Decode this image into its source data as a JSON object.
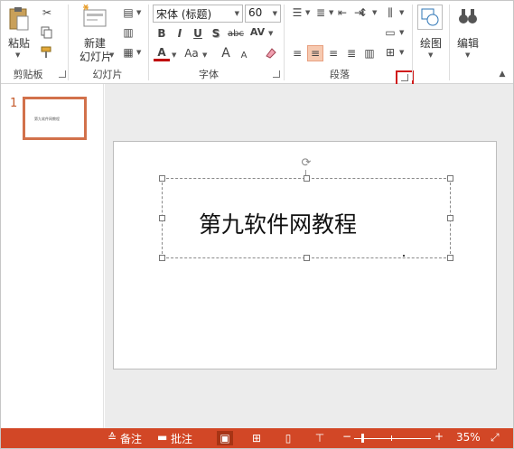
{
  "ribbon": {
    "clipboard": {
      "paste_label": "粘贴",
      "group_label": "剪贴板"
    },
    "slides": {
      "new_slide_label_line1": "新建",
      "new_slide_label_line2": "幻灯片",
      "group_label": "幻灯片"
    },
    "font": {
      "font_name": "宋体 (标题)",
      "font_size": "60",
      "group_label": "字体",
      "bold": "B",
      "italic": "I",
      "underline": "U",
      "shadow": "S",
      "strike": "abc",
      "spacing": "AV",
      "font_color": "A",
      "change_case": "Aa",
      "grow": "A",
      "shrink": "A"
    },
    "paragraph": {
      "group_label": "段落"
    },
    "drawing": {
      "label": "绘图"
    },
    "editing": {
      "label": "编辑"
    }
  },
  "thumbnails": [
    {
      "number": "1",
      "text": "第九软件网教程"
    }
  ],
  "slide": {
    "title": "第九软件网教程"
  },
  "statusbar": {
    "notes_label": "备注",
    "comments_label": "批注",
    "zoom_out": "−",
    "zoom_in": "+",
    "zoom_level": "35%",
    "zoom_fraction": 0.35
  },
  "colors": {
    "accent": "#d24726",
    "highlight_border": "#d01c1c",
    "thumbnail_border": "#d2714b"
  }
}
